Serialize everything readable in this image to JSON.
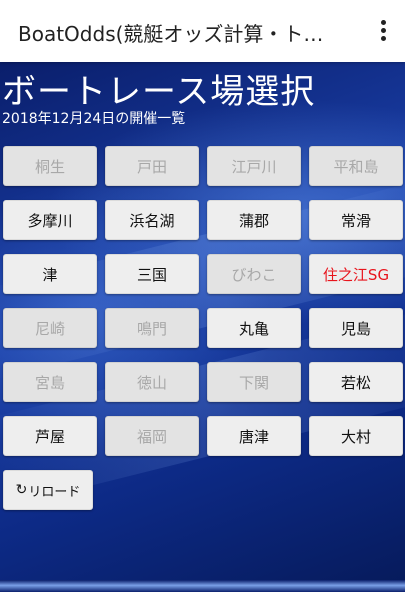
{
  "appbar": {
    "title": "BoatOdds(競艇オッズ計算・ト…",
    "menu_icon": "more-vert-icon"
  },
  "main": {
    "title": "ボートレース場選択",
    "subtitle": "2018年12月24日の開催一覧",
    "venues": [
      {
        "label": "桐生",
        "state": "disabled"
      },
      {
        "label": "戸田",
        "state": "disabled"
      },
      {
        "label": "江戸川",
        "state": "disabled"
      },
      {
        "label": "平和島",
        "state": "disabled"
      },
      {
        "label": "多摩川",
        "state": "enabled"
      },
      {
        "label": "浜名湖",
        "state": "enabled"
      },
      {
        "label": "蒲郡",
        "state": "enabled"
      },
      {
        "label": "常滑",
        "state": "enabled"
      },
      {
        "label": "津",
        "state": "enabled"
      },
      {
        "label": "三国",
        "state": "enabled"
      },
      {
        "label": "びわこ",
        "state": "disabled"
      },
      {
        "label": "住之江SG",
        "state": "highlight"
      },
      {
        "label": "尼崎",
        "state": "disabled"
      },
      {
        "label": "鳴門",
        "state": "disabled"
      },
      {
        "label": "丸亀",
        "state": "enabled"
      },
      {
        "label": "児島",
        "state": "enabled"
      },
      {
        "label": "宮島",
        "state": "disabled"
      },
      {
        "label": "徳山",
        "state": "disabled"
      },
      {
        "label": "下関",
        "state": "disabled"
      },
      {
        "label": "若松",
        "state": "enabled"
      },
      {
        "label": "芦屋",
        "state": "enabled"
      },
      {
        "label": "福岡",
        "state": "disabled"
      },
      {
        "label": "唐津",
        "state": "enabled"
      },
      {
        "label": "大村",
        "state": "enabled"
      }
    ],
    "reload": {
      "icon": "reload-icon",
      "label": "リロード"
    }
  },
  "colors": {
    "background_top": "#0a1e6b",
    "background_mid": "#1a3fa8",
    "highlight_text": "#e8141c",
    "disabled_text": "#a8a8a8"
  }
}
